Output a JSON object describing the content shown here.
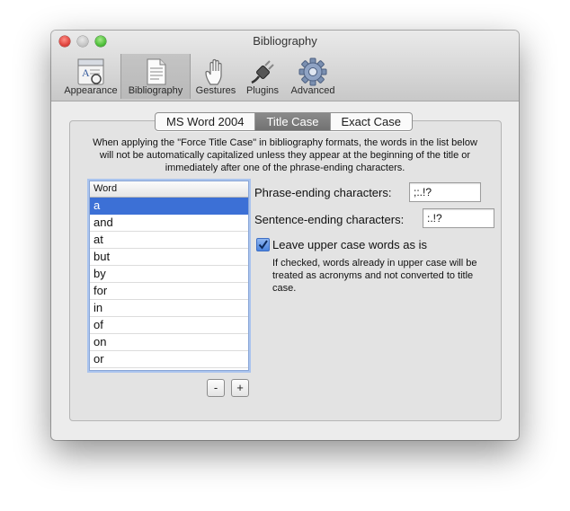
{
  "window": {
    "title": "Bibliography"
  },
  "toolbar": {
    "items": [
      {
        "label": "Appearance",
        "icon": "appearance-icon",
        "selected": false
      },
      {
        "label": "Bibliography",
        "icon": "bibliography-document-icon",
        "selected": true
      },
      {
        "label": "Gestures",
        "icon": "hand-gesture-icon",
        "selected": false
      },
      {
        "label": "Plugins",
        "icon": "plug-icon",
        "selected": false
      },
      {
        "label": "Advanced",
        "icon": "gear-icon",
        "selected": false
      }
    ]
  },
  "tabs": [
    {
      "label": "MS Word 2004",
      "active": false
    },
    {
      "label": "Title Case",
      "active": true
    },
    {
      "label": "Exact Case",
      "active": false
    }
  ],
  "description": "When applying the \"Force Title Case\" in bibliography formats, the words in the list below will not be automatically capitalized unless they appear at the beginning of the title or immediately after one of the phrase-ending characters.",
  "word_list": {
    "header": "Word",
    "rows": [
      "a",
      "and",
      "at",
      "but",
      "by",
      "for",
      "in",
      "of",
      "on",
      "or"
    ],
    "selected_index": 0
  },
  "list_buttons": {
    "remove": "-",
    "add": "+"
  },
  "fields": {
    "phrase_ending": {
      "label": "Phrase-ending characters:",
      "value": ";:.!?"
    },
    "sentence_ending": {
      "label": "Sentence-ending characters:",
      "value": ":.!?"
    }
  },
  "checkbox": {
    "label": "Leave upper case words as is",
    "checked": true,
    "note": "If checked, words already in upper case will be treated as acronyms and not converted to title case."
  },
  "colors": {
    "selection": "#3c70d6",
    "focus_ring": "#aac4ee"
  }
}
